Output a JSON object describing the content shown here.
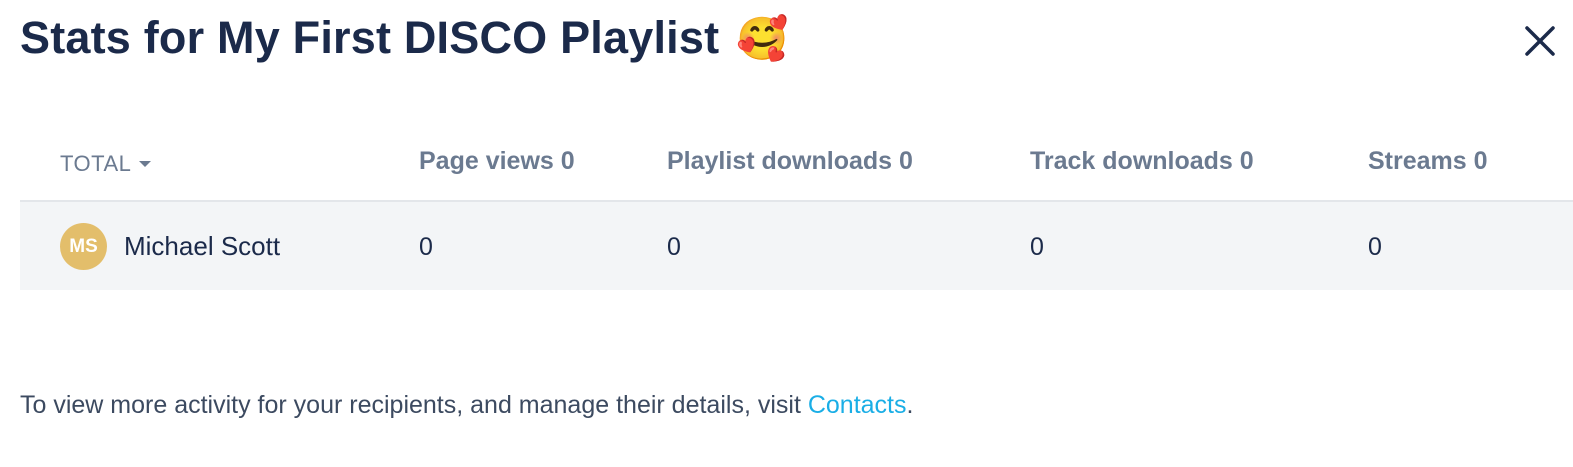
{
  "modal": {
    "title": "Stats for My First DISCO Playlist",
    "title_emoji": "🥰",
    "close_icon": "close-icon"
  },
  "table": {
    "sort_label": "TOTAL",
    "headers": {
      "page_views": "Page views 0",
      "playlist_downloads": "Playlist downloads 0",
      "track_downloads": "Track downloads 0",
      "streams": "Streams 0"
    },
    "rows": [
      {
        "initials": "MS",
        "name": "Michael Scott",
        "avatar_color": "#e3be6b",
        "page_views": "0",
        "playlist_downloads": "0",
        "track_downloads": "0",
        "streams": "0"
      }
    ]
  },
  "footer": {
    "text": "To view more activity for your recipients, and manage their details, visit ",
    "link_label": "Contacts",
    "suffix": ".",
    "link_color": "#1aaee6"
  }
}
